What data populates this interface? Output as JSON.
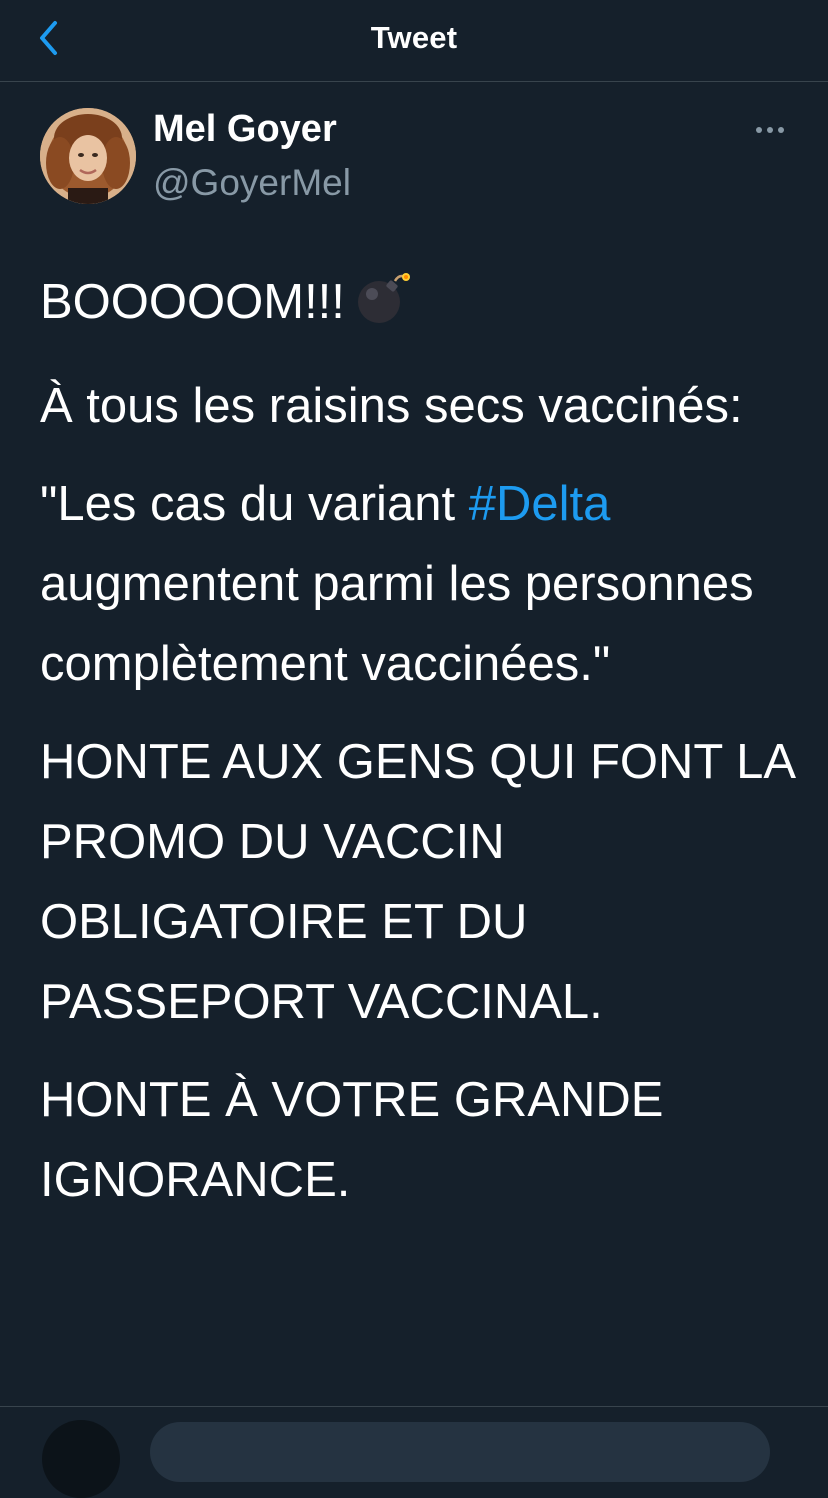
{
  "header": {
    "title": "Tweet",
    "back_icon": "chevron-left-icon"
  },
  "author": {
    "display_name": "Mel Goyer",
    "handle": "@GoyerMel",
    "avatar": "profile-photo"
  },
  "tweet": {
    "line1_text": "BOOOOOM!!!",
    "line1_emoji": "bomb-icon",
    "para2": "À tous les raisins secs vaccinés:",
    "para3_before": "\"Les cas du variant ",
    "para3_hashtag": "#Delta",
    "para3_after": " augmentent parmi les personnes complètement vaccinées.\"",
    "para4": "HONTE AUX GENS QUI FONT LA PROMO DU VACCIN OBLIGATOIRE ET DU PASSEPORT VACCINAL.",
    "para5": "HONTE À VOTRE GRANDE IGNORANCE."
  },
  "colors": {
    "background": "#15202b",
    "divider": "#38444d",
    "accent": "#1d9bf0",
    "secondary_text": "#8899a6"
  }
}
